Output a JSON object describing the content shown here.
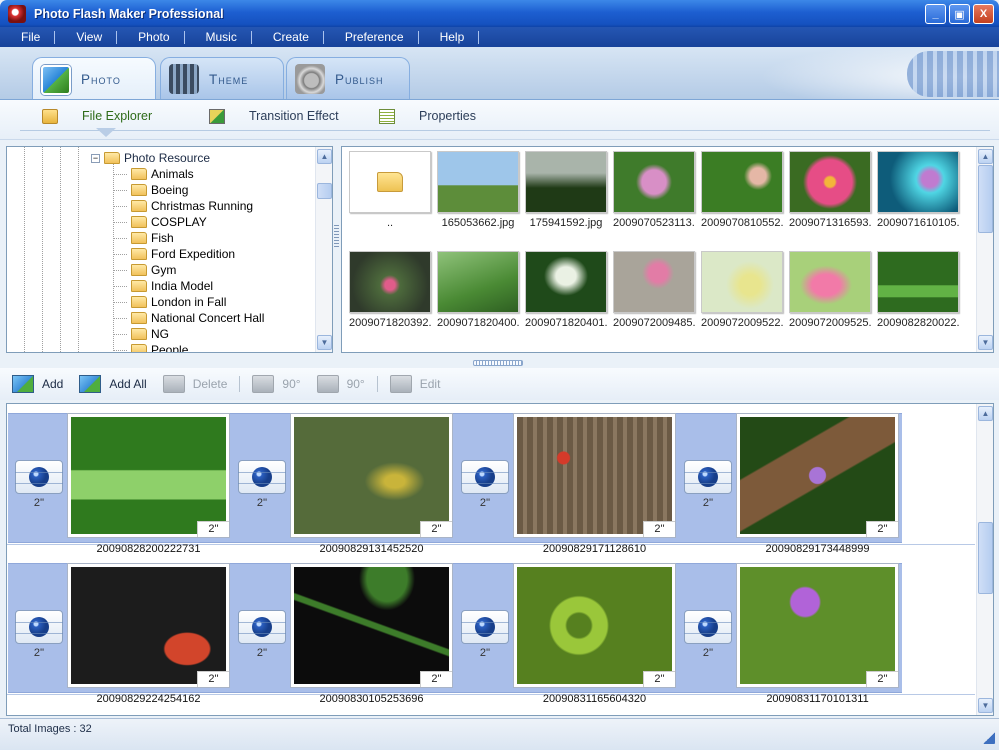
{
  "window": {
    "title": "Photo Flash Maker Professional",
    "buttons": {
      "minimize": "_",
      "maximize": "▣",
      "close": "X"
    }
  },
  "menu": [
    "File",
    "View",
    "Photo",
    "Music",
    "Create",
    "Preference",
    "Help"
  ],
  "main_tabs": [
    {
      "label": "Photo",
      "icon": "photo-icon"
    },
    {
      "label": "Theme",
      "icon": "film-strip-icon"
    },
    {
      "label": "Publish",
      "icon": "disc-icon"
    }
  ],
  "sub_tabs": [
    {
      "label": "File Explorer",
      "icon": "folder-icon"
    },
    {
      "label": "Transition Effect",
      "icon": "transition-icon"
    },
    {
      "label": "Properties",
      "icon": "properties-icon"
    }
  ],
  "tree": {
    "root": {
      "expander": "−",
      "label": "Photo Resource"
    },
    "items": [
      "Animals",
      "Boeing",
      "Christmas Running",
      "COSPLAY",
      "Fish",
      "Ford Expedition",
      "Gym",
      "India Model",
      "London in Fall",
      "National Concert Hall",
      "NG",
      "People"
    ]
  },
  "file_grid": [
    {
      "name": "..",
      "type": "folder"
    },
    {
      "name": "165053662.jpg",
      "colors": [
        "#9ec6ea",
        "#5d8d3a"
      ]
    },
    {
      "name": "175941592.jpg",
      "colors": [
        "#a9b4aa",
        "#1f3a16"
      ]
    },
    {
      "name": "2009070523113...",
      "colors": [
        "#3f7b2b",
        "#d88fc6"
      ]
    },
    {
      "name": "2009070810552...",
      "colors": [
        "#3b7d24",
        "#e5b7a6"
      ]
    },
    {
      "name": "2009071316593...",
      "colors": [
        "#3a6b22",
        "#e64d86"
      ]
    },
    {
      "name": "2009071610105...",
      "colors": [
        "#0e5c7a",
        "#4fd6e4"
      ]
    },
    {
      "name": "2009071820392...",
      "colors": [
        "#2f3a2b",
        "#e05c8a"
      ]
    },
    {
      "name": "2009071820400...",
      "colors": [
        "#4a8a34",
        "#8fc27a"
      ]
    },
    {
      "name": "2009071820401...",
      "colors": [
        "#1f4a1a",
        "#eaf1e4"
      ]
    },
    {
      "name": "2009072009485...",
      "colors": [
        "#a9a49a",
        "#e27ca6"
      ]
    },
    {
      "name": "2009072009522...",
      "colors": [
        "#dbe8c7",
        "#e8e58e"
      ]
    },
    {
      "name": "2009072009525...",
      "colors": [
        "#a8d07a",
        "#f27aa8"
      ]
    },
    {
      "name": "2009082820022...",
      "colors": [
        "#2e6b1f",
        "#62b245"
      ]
    }
  ],
  "toolbar": [
    {
      "label": "Add",
      "enabled": true,
      "icon": "add-photo-icon"
    },
    {
      "label": "Add All",
      "enabled": true,
      "icon": "add-all-icon"
    },
    {
      "label": "Delete",
      "enabled": false,
      "icon": "delete-icon"
    },
    {
      "label": "90°",
      "enabled": false,
      "icon": "rotate-left-icon"
    },
    {
      "label": "90°",
      "enabled": false,
      "icon": "rotate-right-icon"
    },
    {
      "label": "Edit",
      "enabled": false,
      "icon": "edit-icon"
    }
  ],
  "storyboard": {
    "rows": [
      [
        {
          "name": "20090828200222731",
          "duration": "2''",
          "transition_duration": "2''",
          "colors": [
            "#2f7a1e",
            "#8ed06a"
          ]
        },
        {
          "name": "20090829131452520",
          "duration": "2''",
          "transition_duration": "2''",
          "colors": [
            "#556b3a",
            "#b7c98d"
          ]
        },
        {
          "name": "20090829171128610",
          "duration": "2''",
          "transition_duration": "2''",
          "colors": [
            "#6b5a45",
            "#d53a2a"
          ]
        },
        {
          "name": "20090829173448999",
          "duration": "2''",
          "transition_duration": "2''",
          "colors": [
            "#234a16",
            "#7d5a3a"
          ]
        }
      ],
      [
        {
          "name": "20090829224254162",
          "duration": "2''",
          "transition_duration": "2''",
          "colors": [
            "#1c1c1c",
            "#d2452b"
          ]
        },
        {
          "name": "20090830105253696",
          "duration": "2''",
          "transition_duration": "2''",
          "colors": [
            "#0c0c0c",
            "#3d7c2a"
          ]
        },
        {
          "name": "20090831165604320",
          "duration": "2''",
          "transition_duration": "2''",
          "colors": [
            "#9ac73a",
            "#56801f"
          ]
        },
        {
          "name": "20090831170101311",
          "duration": "2''",
          "transition_duration": "2''",
          "colors": [
            "#5e8f2a",
            "#b163d8"
          ]
        }
      ]
    ]
  },
  "status": {
    "text": "Total Images : 32"
  }
}
